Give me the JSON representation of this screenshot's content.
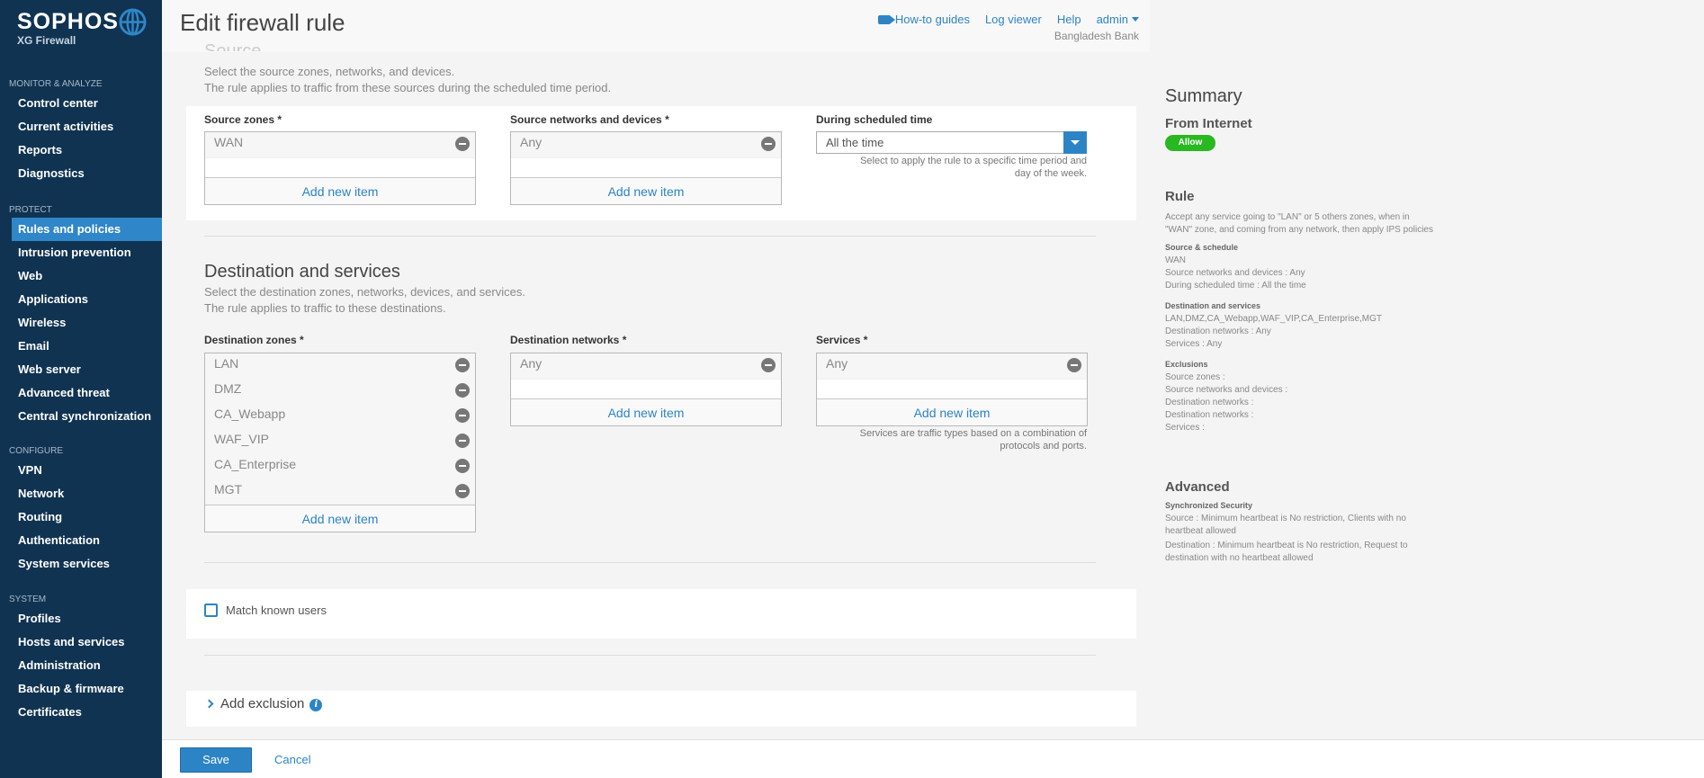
{
  "logo": {
    "brand": "SOPHOS",
    "product": "XG Firewall"
  },
  "sidebar": {
    "groups": [
      {
        "header": "MONITOR & ANALYZE",
        "items": [
          "Control center",
          "Current activities",
          "Reports",
          "Diagnostics"
        ]
      },
      {
        "header": "PROTECT",
        "items": [
          "Rules and policies",
          "Intrusion prevention",
          "Web",
          "Applications",
          "Wireless",
          "Email",
          "Web server",
          "Advanced threat",
          "Central synchronization"
        ]
      },
      {
        "header": "CONFIGURE",
        "items": [
          "VPN",
          "Network",
          "Routing",
          "Authentication",
          "System services"
        ]
      },
      {
        "header": "SYSTEM",
        "items": [
          "Profiles",
          "Hosts and services",
          "Administration",
          "Backup & firmware",
          "Certificates"
        ]
      }
    ],
    "active_item": "Rules and policies"
  },
  "header": {
    "title": "Edit firewall rule",
    "links": {
      "howto": "How-to guides",
      "logviewer": "Log viewer",
      "help": "Help",
      "admin": "admin"
    },
    "org": "Bangladesh Bank"
  },
  "source": {
    "faded_title": "Source",
    "desc1": "Select the source zones, networks, and devices.",
    "desc2": "The rule applies to traffic from these sources during the scheduled time period.",
    "zones_label": "Source zones *",
    "zones": [
      "WAN"
    ],
    "networks_label": "Source networks and devices *",
    "networks": [
      "Any"
    ],
    "schedule_label": "During scheduled time",
    "schedule_value": "All the time",
    "schedule_hint": "Select to apply the rule to a specific time period and day of the week.",
    "add_new": "Add new item"
  },
  "destination": {
    "title": "Destination and services",
    "desc1": "Select the destination zones, networks, devices, and services.",
    "desc2": "The rule applies to traffic to these destinations.",
    "zones_label": "Destination zones *",
    "zones": [
      "LAN",
      "DMZ",
      "CA_Webapp",
      "WAF_VIP",
      "CA_Enterprise",
      "MGT"
    ],
    "networks_label": "Destination networks *",
    "networks": [
      "Any"
    ],
    "services_label": "Services *",
    "services": [
      "Any"
    ],
    "services_hint": "Services are traffic types based on a combination of protocols and ports.",
    "add_new": "Add new item"
  },
  "match_users": {
    "label": "Match known users",
    "checked": false
  },
  "exclusion": {
    "label": "Add exclusion"
  },
  "footer": {
    "save": "Save",
    "cancel": "Cancel"
  },
  "summary": {
    "title": "Summary",
    "subtitle": "From Internet",
    "badge": "Allow",
    "rule_h": "Rule",
    "rule_text": "Accept any service going to \"LAN\" or 5 others zones, when in \"WAN\" zone, and coming from any network, then apply IPS policies",
    "src_h": "Source & schedule",
    "src_lines": [
      "WAN",
      "Source networks and devices : Any",
      "During scheduled time : All the time"
    ],
    "dst_h": "Destination and services",
    "dst_lines": [
      "LAN,DMZ,CA_Webapp,WAF_VIP,CA_Enterprise,MGT",
      "Destination networks : Any",
      "Services : Any"
    ],
    "exc_h": "Exclusions",
    "exc_lines": [
      "Source zones :",
      "Source networks and devices :",
      "Destination networks :",
      "Destination networks :",
      "Services :"
    ],
    "adv_h": "Advanced",
    "sync_h": "Synchronized Security",
    "sync_lines": [
      "Source : Minimum heartbeat is No restriction, Clients with no heartbeat allowed",
      "Destination : Minimum heartbeat is No restriction, Request to destination with no heartbeat allowed"
    ]
  },
  "colors": {
    "sidebar": "#103352",
    "accent": "#2d84c4",
    "allow": "#28b81f"
  }
}
